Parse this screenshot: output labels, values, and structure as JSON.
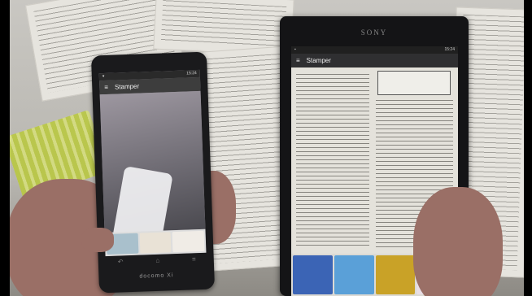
{
  "left_phone": {
    "status_time": "15:24",
    "app_title": "Stamper",
    "brand": "docomo Xi"
  },
  "tablet": {
    "brand": "SONY",
    "status_time": "15:24",
    "app_title": "Stamper"
  }
}
